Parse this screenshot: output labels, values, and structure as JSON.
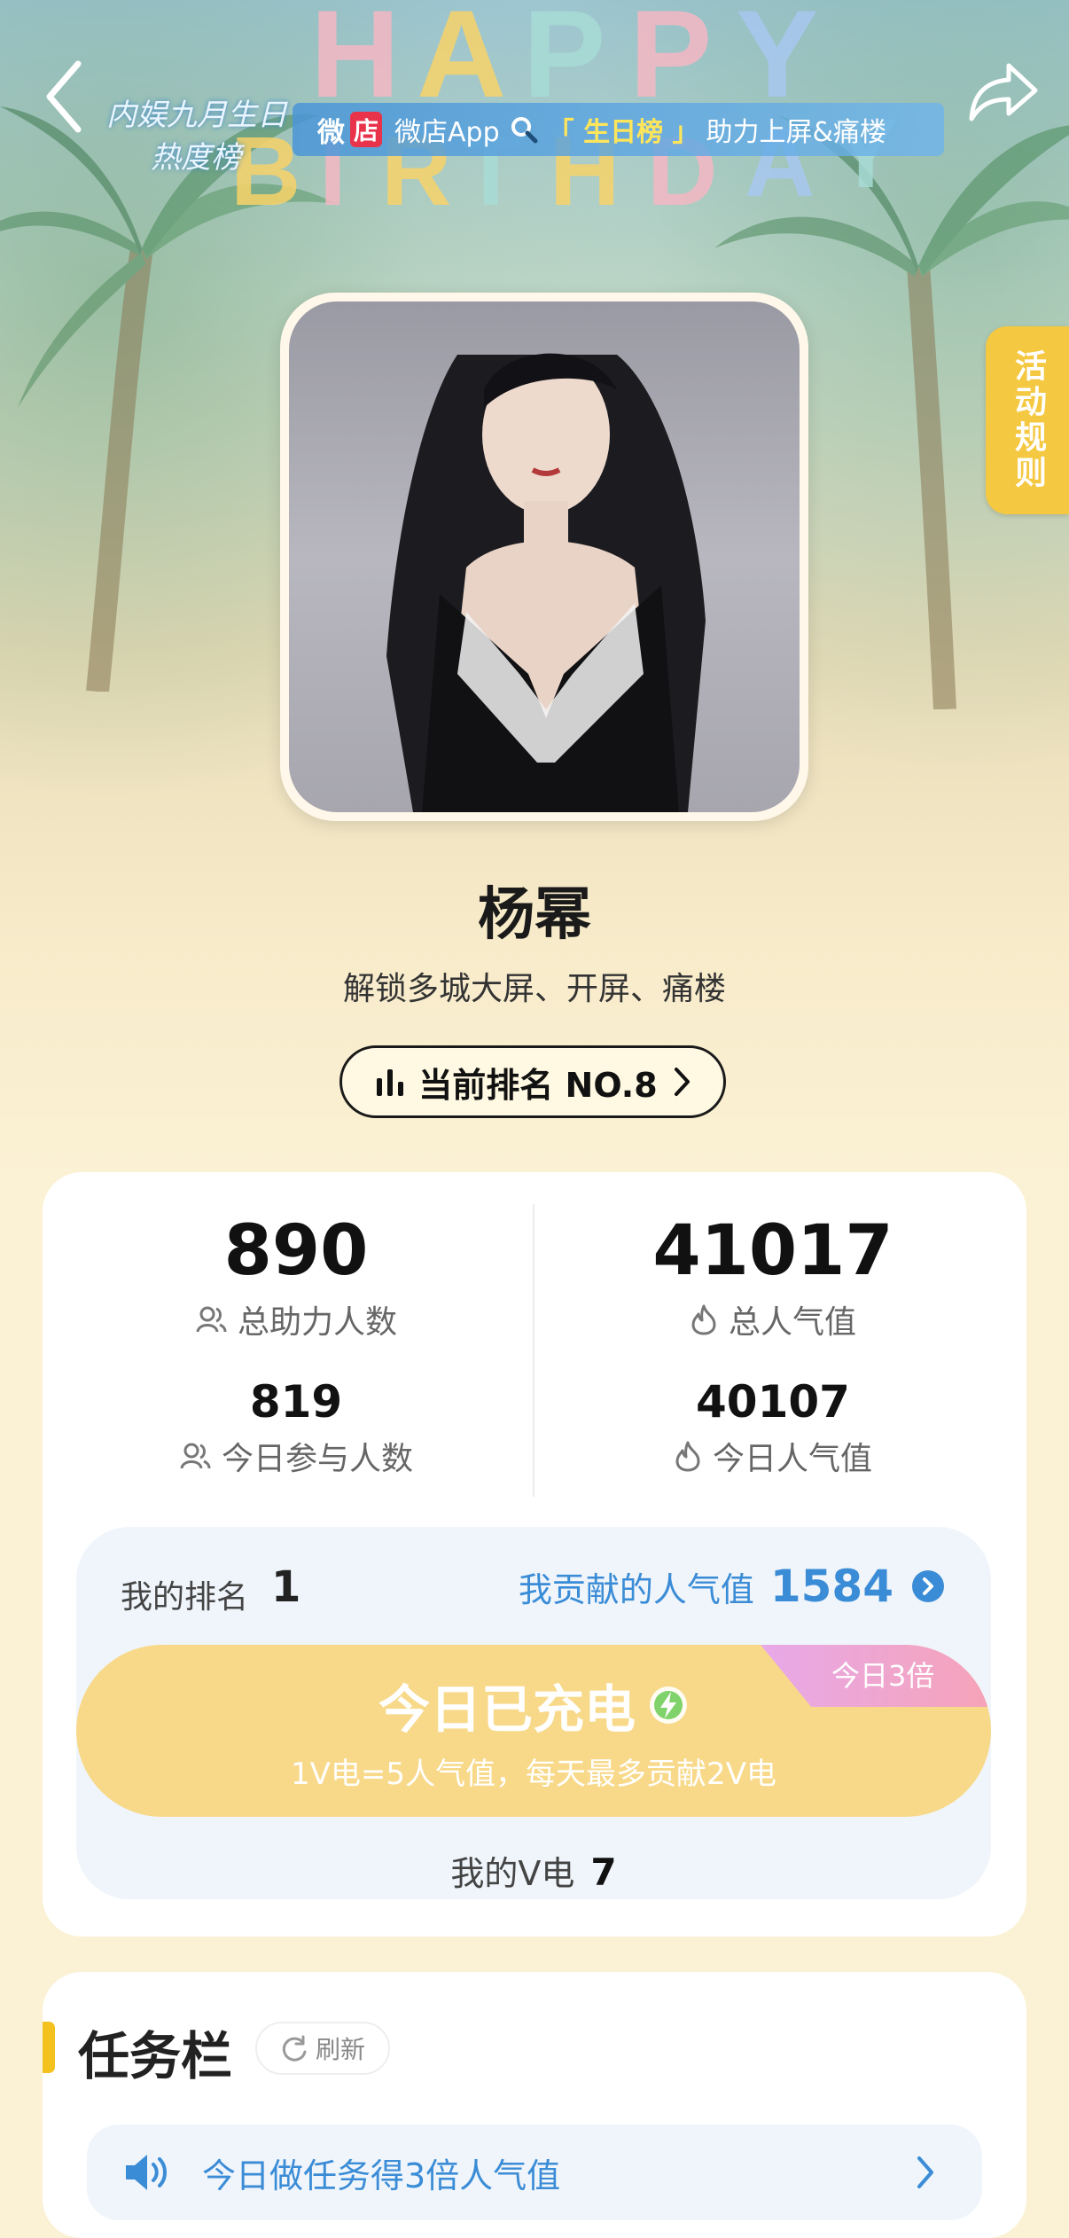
{
  "header": {
    "logo_line1": "内娱九月生日",
    "logo_line2": "热度榜",
    "banner": {
      "wei": "微",
      "dian": "店",
      "app": "微店App",
      "tag": "「 生日榜 」",
      "rest": "助力上屏&痛楼"
    },
    "happy_letters": [
      "H",
      "A",
      "P",
      "P",
      "Y"
    ],
    "birthday_letters": [
      "B",
      "I",
      "R",
      "T",
      "H",
      "D",
      "A",
      "Y"
    ]
  },
  "rules_tab": "活动规则",
  "profile": {
    "name": "杨幂",
    "subtitle": "解锁多城大屏、开屏、痛楼",
    "rank_label": "当前排名 NO.8"
  },
  "stats": {
    "total_helpers": "890",
    "total_helpers_label": "总助力人数",
    "total_popularity": "41017",
    "total_popularity_label": "总人气值",
    "today_participants": "819",
    "today_participants_label": "今日参与人数",
    "today_popularity": "40107",
    "today_popularity_label": "今日人气值"
  },
  "mine": {
    "rank_label": "我的排名",
    "rank_value": "1",
    "contrib_label": "我贡献的人气值",
    "contrib_value": "1584",
    "charge_badge": "今日3倍",
    "charge_title": "今日已充电",
    "charge_sub": "1V电=5人气值，每天最多贡献2V电",
    "v_label": "我的V电",
    "v_value": "7"
  },
  "tasks": {
    "title": "任务栏",
    "refresh": "刷新",
    "row_text": "今日做任务得3倍人气值"
  },
  "colors": {
    "accent_blue": "#3b8cd6",
    "charge_yellow": "#f8d98a",
    "tab_yellow": "#f5c842"
  }
}
